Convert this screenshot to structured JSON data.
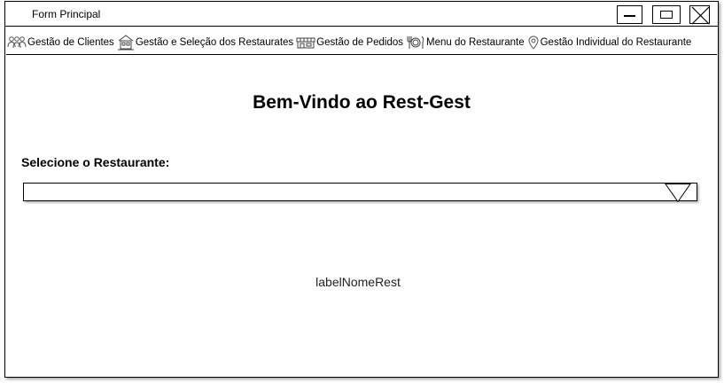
{
  "window": {
    "title": "Form Principal"
  },
  "menu": {
    "items": [
      {
        "label": "Gestão de Clientes",
        "icon": "users-icon"
      },
      {
        "label": "Gestão e Seleção dos Restaurates",
        "icon": "building-icon"
      },
      {
        "label": "Gestão de Pedidos",
        "icon": "storefront-icon"
      },
      {
        "label": "Menu do Restaurante",
        "icon": "cutlery-icon"
      },
      {
        "label": "Gestão Individual do Restaurante",
        "icon": "location-pin-icon"
      }
    ]
  },
  "main": {
    "heading": "Bem-Vindo ao Rest-Gest",
    "select_label": "Selecione o Restaurante:",
    "restaurant_select": {
      "value": ""
    },
    "name_label": "labelNomeRest"
  }
}
